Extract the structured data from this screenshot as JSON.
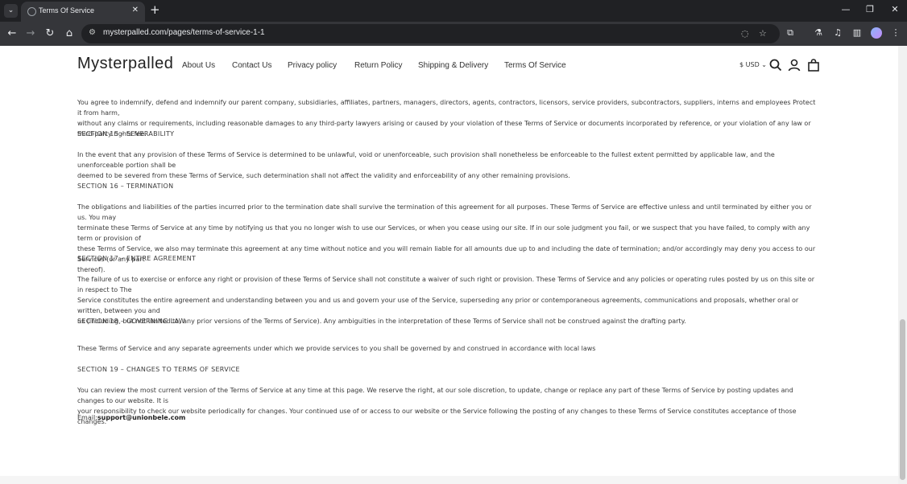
{
  "browser": {
    "tab_title": "Terms Of Service",
    "url": "mysterpalled.com/pages/terms-of-service-1-1",
    "icons": [
      "tab-search-icon",
      "close-icon",
      "new-tab-icon",
      "minimize-icon",
      "maximize-icon",
      "close-window-icon",
      "back-icon",
      "forward-icon",
      "reload-icon",
      "home-icon",
      "site-info-icon",
      "eye-off-icon",
      "star-icon",
      "extensions-icon",
      "labs-icon",
      "media-icon",
      "sidebar-icon",
      "avatar",
      "menu-icon"
    ]
  },
  "header": {
    "brand": "Mysterpalled",
    "nav": [
      "About Us",
      "Contact Us",
      "Privacy policy",
      "Return Policy",
      "Shipping & Delivery",
      "Terms Of Service"
    ],
    "currency": "$ USD",
    "icons": [
      "search-icon",
      "account-icon",
      "cart-icon"
    ]
  },
  "content": {
    "p_indemnify": [
      "You agree to indemnify, defend and indemnify our parent company, subsidiaries, affiliates, partners, managers, directors, agents, contractors, licensors, service providers, subcontractors, suppliers, interns and employees Protect it from harm,",
      "without any claims or requirements, including reasonable damages to any third-party lawyers arising or caused by your violation of these Terms of Service or documents incorporated by reference, or your violation of any law or third-party rights fee."
    ],
    "s15": "SECTION 15 – SEVERABILITY",
    "p15": [
      "In the event that any provision of these Terms of Service is determined to be unlawful, void or unenforceable, such provision shall nonetheless be enforceable to the fullest extent permitted by applicable law, and the unenforceable portion shall be",
      "deemed to be severed from these Terms of Service, such determination shall not affect the validity and enforceability of any other remaining provisions."
    ],
    "s16": "SECTION 16 – TERMINATION",
    "p16": [
      "The obligations and liabilities of the parties incurred prior to the termination date shall survive the termination of this agreement for all purposes. These Terms of Service are effective unless and until terminated by either you or us. You may",
      "terminate these Terms of Service at any time by notifying us that you no longer wish to use our Services, or when you cease using our site. If in our sole judgment you fail, or we suspect that you have failed, to comply with any term or provision of",
      "these Terms of Service, we also may terminate this agreement at any time without notice and you will remain liable for all amounts due up to and including the date of termination; and/or accordingly may deny you access to our Services (or any part",
      "thereof)."
    ],
    "s17": "SECTION 17 – ENTIRE AGREEMENT",
    "p17": [
      "The failure of us to exercise or enforce any right or provision of these Terms of Service shall not constitute a waiver of such right or provision. These Terms of Service and any policies or operating rules posted by us on this site or in respect to The",
      "Service constitutes the entire agreement and understanding between you and us and govern your use of the Service, superseding any prior or contemporaneous agreements, communications and proposals, whether oral or written, between you and",
      "us (including, but not limited to, any prior versions of the Terms of Service). Any ambiguities in the interpretation of these Terms of Service shall not be construed against the drafting party."
    ],
    "s18": "SECTION 18 – GOVERNING LAW",
    "p18": "These Terms of Service and any separate agreements under which we provide services to you shall be governed by and construed in accordance with local laws",
    "s19": "SECTION 19 – CHANGES TO TERMS OF SERVICE",
    "p19": [
      "You can review the most current version of the Terms of Service at any time at this page. We reserve the right, at our sole discretion, to update, change or replace any part of these Terms of Service by posting updates and changes to our website. It is",
      "your responsibility to check our website periodically for changes. Your continued use of or access to our website or the Service following the posting of any changes to these Terms of Service constitutes acceptance of those changes."
    ],
    "email_label": "Email:",
    "email": "support@unionbele.com"
  }
}
